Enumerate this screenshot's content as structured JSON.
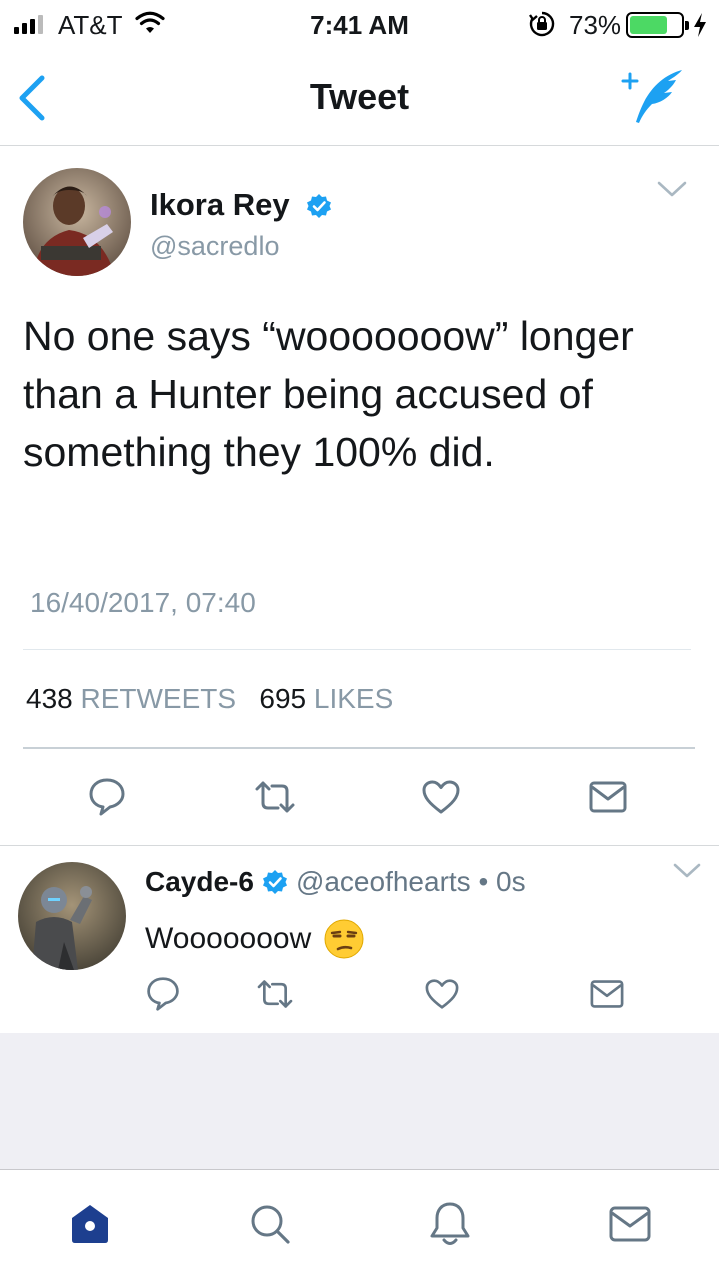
{
  "status_bar": {
    "carrier": "AT&T",
    "time": "7:41 AM",
    "battery_percent": "73%",
    "battery_level": 0.73,
    "battery_color": "#4cd964"
  },
  "nav": {
    "title": "Tweet",
    "back_icon": "chevron-left-icon",
    "compose_icon": "compose-feather-icon",
    "accent": "#1da1f2"
  },
  "main_tweet": {
    "author": {
      "name": "Ikora Rey",
      "handle": "@sacredlo",
      "verified": true
    },
    "text": "No one says “wooooooow” longer than a Hunter being accused of something they 100% did.",
    "timestamp": "16/40/2017, 07:40",
    "stats": {
      "retweets_count": "438",
      "retweets_label": "RETWEETS",
      "likes_count": "695",
      "likes_label": "LIKES"
    },
    "actions": [
      "reply-icon",
      "retweet-icon",
      "like-heart-icon",
      "direct-message-icon"
    ]
  },
  "reply": {
    "author": {
      "name": "Cayde-6",
      "handle": "@aceofhearts",
      "verified": true
    },
    "meta": "@aceofhearts • 0s",
    "text": "Wooooooow",
    "emoji": "unamused-face-emoji",
    "actions": [
      "reply-icon",
      "retweet-icon",
      "like-heart-icon",
      "direct-message-icon"
    ]
  },
  "tab_bar": {
    "tabs": [
      "home-icon",
      "search-icon",
      "notifications-bell-icon",
      "messages-icon"
    ],
    "active": "home-icon",
    "active_color": "#1d3f8f"
  }
}
